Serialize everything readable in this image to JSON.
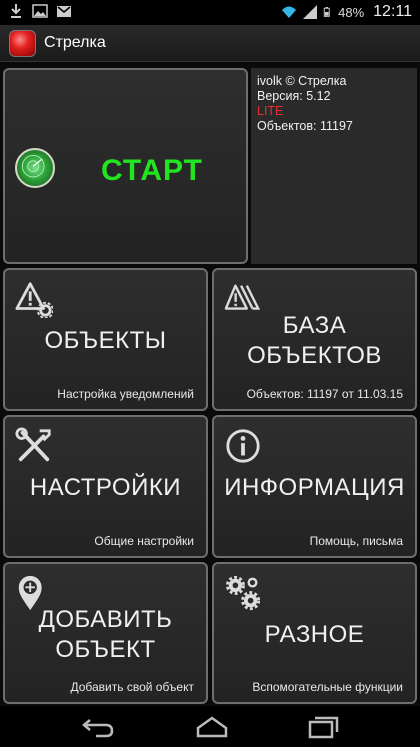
{
  "status_bar": {
    "battery": "48%",
    "time": "12:11",
    "icons": [
      "download-icon",
      "image-icon",
      "gmail-icon",
      "wifi-icon",
      "signal-icon",
      "battery-icon"
    ]
  },
  "app_bar": {
    "title": "Стрелка",
    "icon": "app-logo-icon"
  },
  "start_tile": {
    "label": "СТАРТ",
    "icon": "radar-icon",
    "label_color": "#22e51f"
  },
  "info": {
    "line1": "ivolk © Стрелка",
    "line2": "Версия: 5.12",
    "line3": "LITE",
    "line4": "Объектов: 11197"
  },
  "tiles": {
    "objects": {
      "label": "ОБЪЕКТЫ",
      "sub": "Настройка уведомлений",
      "icon": "warning-gear-icon"
    },
    "database": {
      "label1": "БАЗА",
      "label2": "ОБЪЕКТОВ",
      "sub": "Объектов: 11197 от 11.03.15",
      "icon": "warning-stack-icon"
    },
    "settings": {
      "label": "НАСТРОЙКИ",
      "sub": "Общие настройки",
      "icon": "tools-icon"
    },
    "information": {
      "label": "ИНФОРМАЦИЯ",
      "sub": "Помощь, письма",
      "icon": "info-icon"
    },
    "add_object": {
      "label1": "ДОБАВИТЬ",
      "label2": "ОБЪЕКТ",
      "sub": "Добавить свой объект",
      "icon": "add-location-icon"
    },
    "misc": {
      "label": "РАЗНОЕ",
      "sub": "Вспомогательные функции",
      "icon": "gears-icon"
    }
  },
  "nav_bar": {
    "icons": [
      "back-icon",
      "home-icon",
      "recents-icon"
    ]
  }
}
